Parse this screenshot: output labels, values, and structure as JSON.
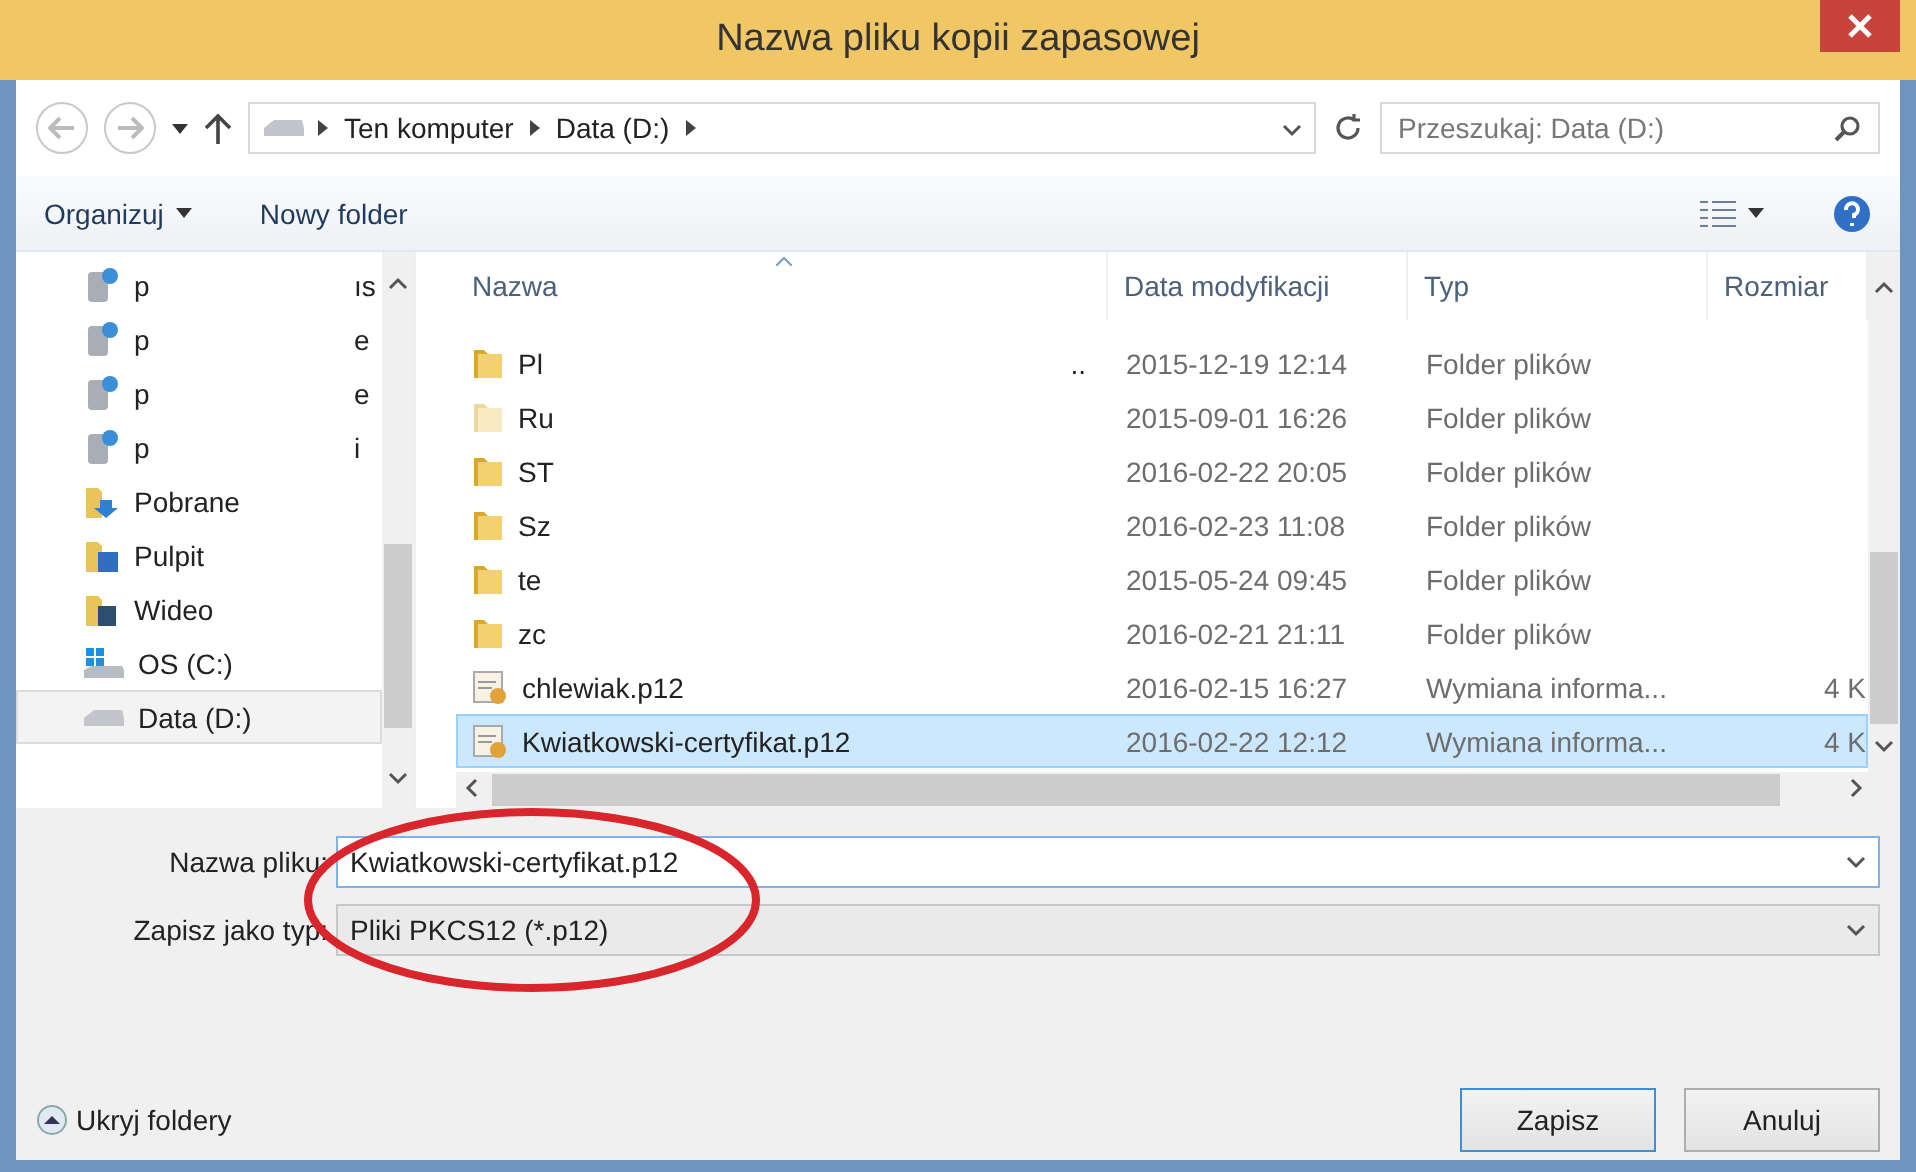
{
  "window": {
    "title": "Nazwa pliku kopii zapasowej"
  },
  "nav": {
    "path": [
      "Ten komputer",
      "Data (D:)"
    ],
    "search_placeholder": "Przeszukaj: Data (D:)"
  },
  "commands": {
    "organize": "Organizuj",
    "new_folder": "Nowy folder"
  },
  "sidebar": {
    "items": [
      {
        "label": "p",
        "tail": "ıs",
        "kind": "network",
        "selected": false
      },
      {
        "label": "p",
        "tail": "e",
        "kind": "network",
        "selected": false
      },
      {
        "label": "p",
        "tail": "e",
        "kind": "network",
        "selected": false
      },
      {
        "label": "p",
        "tail": "i",
        "kind": "network",
        "selected": false
      },
      {
        "label": "Pobrane",
        "kind": "downloads",
        "selected": false
      },
      {
        "label": "Pulpit",
        "kind": "desktop",
        "selected": false
      },
      {
        "label": "Wideo",
        "kind": "videos",
        "selected": false
      },
      {
        "label": "OS (C:)",
        "kind": "system_drive",
        "selected": false
      },
      {
        "label": "Data (D:)",
        "kind": "drive",
        "selected": true
      }
    ]
  },
  "table": {
    "columns": [
      "Nazwa",
      "Data modyfikacji",
      "Typ",
      "Rozmiar"
    ],
    "rows": [
      {
        "name": "Pl",
        "trail": "..",
        "date": "2015-12-19 12:14",
        "type": "Folder plików",
        "kind": "folder",
        "selected": false
      },
      {
        "name": "Ru",
        "date": "2015-09-01 16:26",
        "type": "Folder plików",
        "kind": "folder_light",
        "selected": false
      },
      {
        "name": "ST",
        "date": "2016-02-22 20:05",
        "type": "Folder plików",
        "kind": "folder",
        "selected": false
      },
      {
        "name": "Sz",
        "date": "2016-02-23 11:08",
        "type": "Folder plików",
        "kind": "folder",
        "selected": false
      },
      {
        "name": "te",
        "date": "2015-05-24 09:45",
        "type": "Folder plików",
        "kind": "folder",
        "selected": false
      },
      {
        "name": "zc",
        "date": "2016-02-21 21:11",
        "type": "Folder plików",
        "kind": "folder",
        "selected": false
      },
      {
        "name": "chlewiak.p12",
        "date": "2016-02-15 16:27",
        "type": "Wymiana informa...",
        "size": "4 K",
        "kind": "certificate",
        "selected": false
      },
      {
        "name": "Kwiatkowski-certyfikat.p12",
        "date": "2016-02-22 12:12",
        "type": "Wymiana informa...",
        "size": "4 K",
        "kind": "certificate",
        "selected": true
      }
    ]
  },
  "filename": {
    "label": "Nazwa pliku:",
    "value": "Kwiatkowski-certyfikat.p12"
  },
  "filetype": {
    "label": "Zapisz jako typ:",
    "value": "Pliki PKCS12 (*.p12)"
  },
  "hide_folders": "Ukryj foldery",
  "buttons": [
    "Zapisz",
    "Anuluj"
  ]
}
